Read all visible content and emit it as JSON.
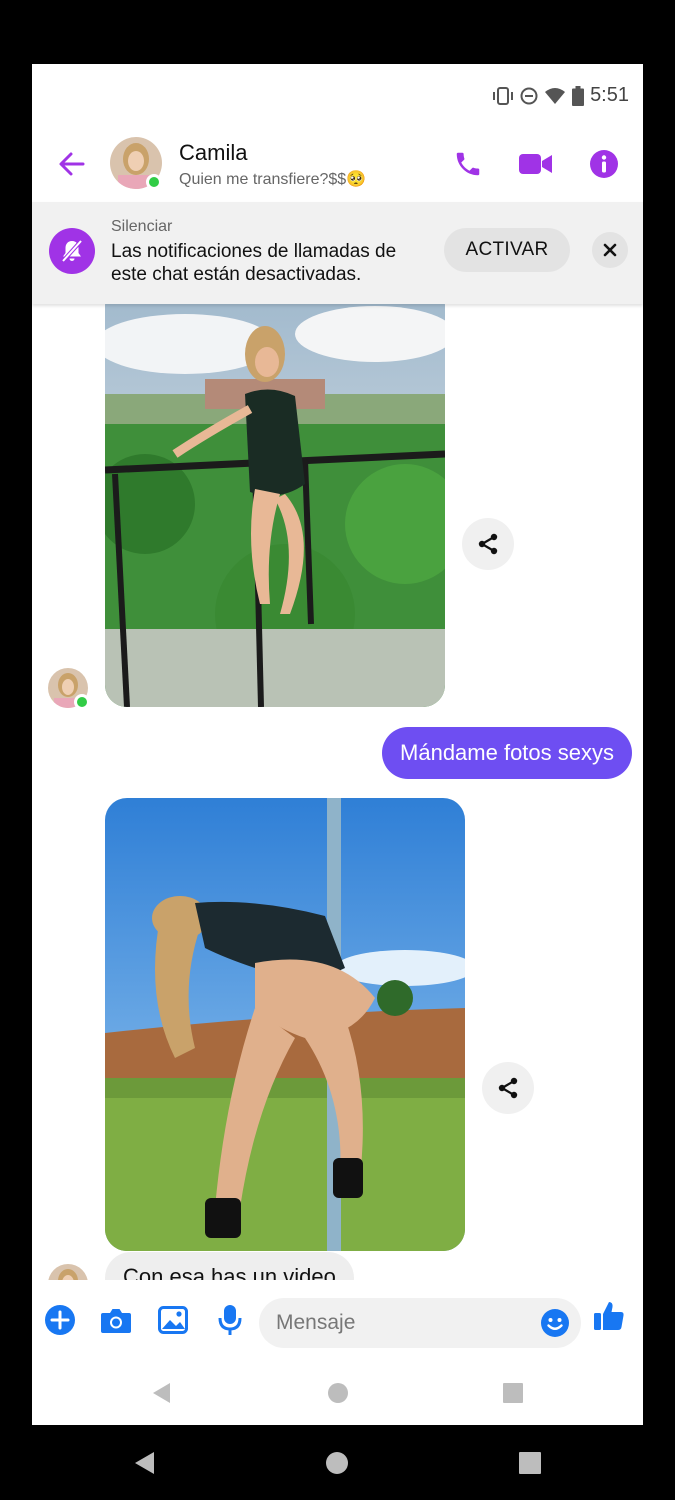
{
  "status": {
    "time": "5:51"
  },
  "header": {
    "contact_name": "Camila",
    "contact_status": "Quien me transfiere?$$🥺",
    "accent_color": "#a033e6"
  },
  "banner": {
    "title": "Silenciar",
    "text": "Las notificaciones de llamadas de este chat están desactivadas.",
    "button_label": "ACTIVAR"
  },
  "messages": [
    {
      "direction": "incoming",
      "type": "photo",
      "description": "photo"
    },
    {
      "direction": "outgoing",
      "type": "text",
      "text": "Mándame fotos sexys"
    },
    {
      "direction": "incoming",
      "type": "photo",
      "description": "photo"
    },
    {
      "direction": "incoming",
      "type": "text",
      "text": "Con esa has un video"
    }
  ],
  "composer": {
    "placeholder": "Mensaje",
    "accent_color": "#1877f2"
  },
  "colors": {
    "outgoing_bubble": "#6e4ef2",
    "incoming_bubble": "#eeeeee",
    "online": "#31cc46"
  }
}
